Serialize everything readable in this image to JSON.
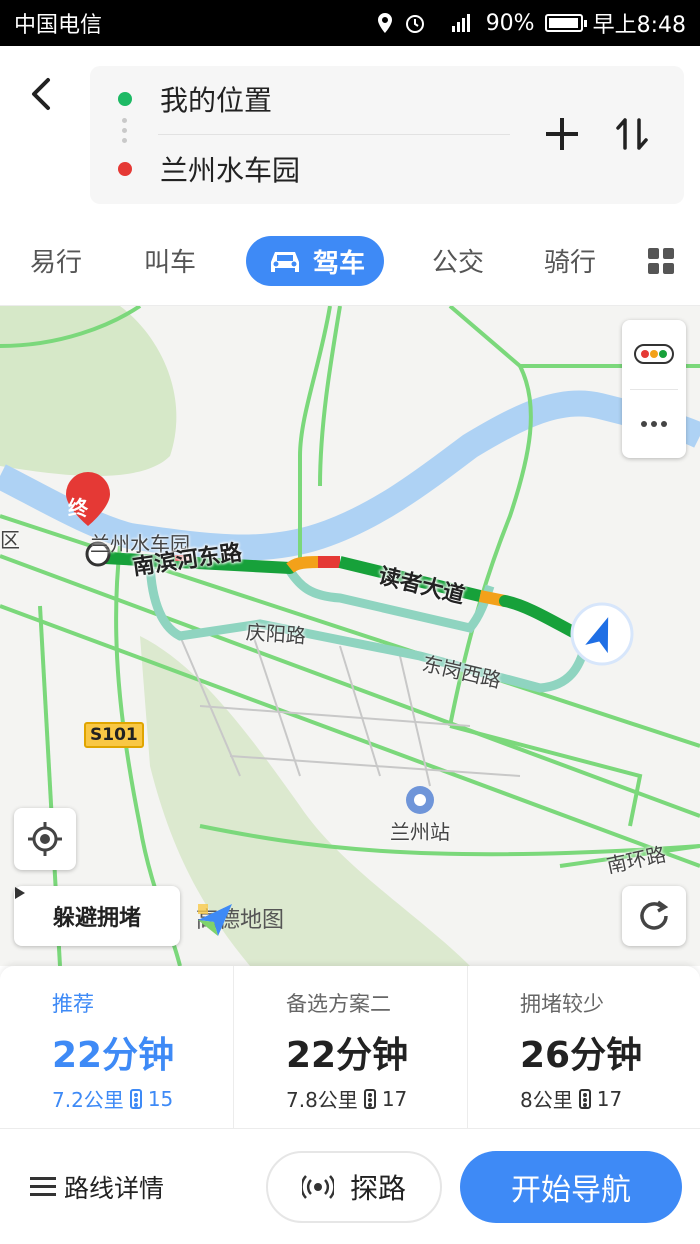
{
  "status_bar": {
    "carrier": "中国电信",
    "network": "3G 2G",
    "battery": "90%",
    "time": "早上8:48",
    "battery_level": 0.9
  },
  "route": {
    "origin": "我的位置",
    "destination": "兰州水车园",
    "origin_color": "#1db964",
    "destination_color": "#e53935"
  },
  "modes": {
    "items": [
      "易行",
      "叫车",
      "驾车",
      "公交",
      "骑行"
    ],
    "active": "驾车"
  },
  "map": {
    "dest_marker": "终",
    "dest_label": "兰州水车园",
    "left_edge_label": "区",
    "roads": {
      "nanbin": "南滨河东路",
      "duzhe": "读者大道",
      "qingyang": "庆阳路",
      "donggang": "东岗西路",
      "nanhuan": "南环路"
    },
    "highway": "S101",
    "station": "兰州站",
    "avoid_button": "躲避拥堵",
    "brand": "高德地图",
    "accent": "#3e8af6"
  },
  "options": [
    {
      "label": "推荐",
      "time": "22分钟",
      "distance": "7.2公里",
      "lights": "15"
    },
    {
      "label": "备选方案二",
      "time": "22分钟",
      "distance": "7.8公里",
      "lights": "17"
    },
    {
      "label": "拥堵较少",
      "time": "26分钟",
      "distance": "8公里",
      "lights": "17"
    }
  ],
  "bottom": {
    "details": "路线详情",
    "explore": "探路",
    "start": "开始导航"
  }
}
